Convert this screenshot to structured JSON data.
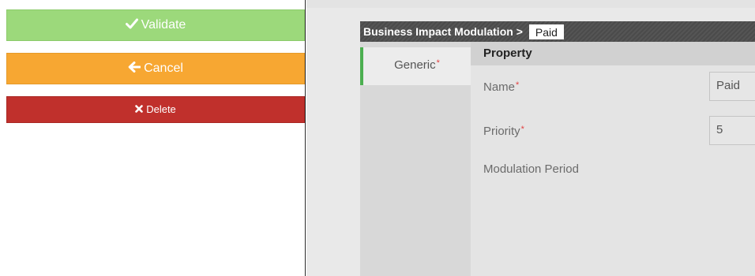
{
  "actions": {
    "validate": {
      "label": "Validate",
      "icon": "check-icon",
      "color": "#9cd97b"
    },
    "cancel": {
      "label": "Cancel",
      "icon": "arrow-left-icon",
      "color": "#f7a732"
    },
    "delete": {
      "label": "Delete",
      "icon": "times-icon",
      "color": "#c0302c"
    }
  },
  "header": {
    "title": "Business Impact Modulation >",
    "value": "Paid"
  },
  "tabs": [
    {
      "label": "Generic",
      "required_mark": "*",
      "active": true,
      "accent": "#4caf50"
    }
  ],
  "form": {
    "section_title": "Property",
    "fields": [
      {
        "label": "Name",
        "required_mark": "*",
        "value": "Paid"
      },
      {
        "label": "Priority",
        "required_mark": "*",
        "value": "5"
      },
      {
        "label": "Modulation Period"
      }
    ]
  }
}
